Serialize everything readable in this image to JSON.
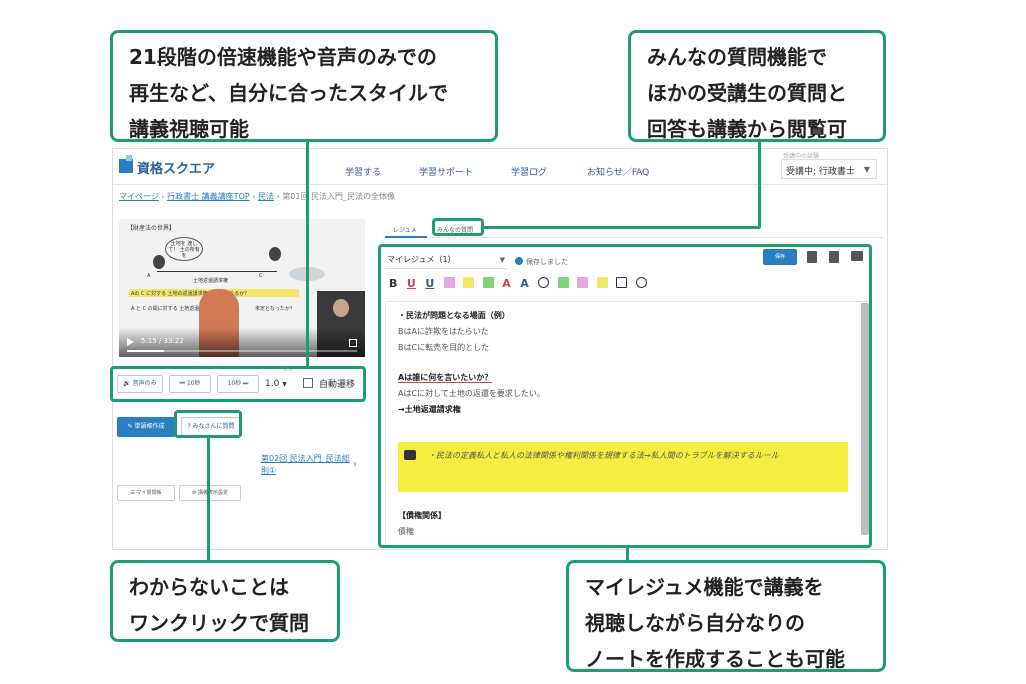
{
  "callouts": {
    "speed": [
      "21段階の倍速機能や音声のみでの",
      "再生など、自分に合ったスタイルで",
      "講義視聴可能"
    ],
    "questions": [
      "みんなの質問機能で",
      "ほかの受講生の質問と",
      "回答も講義から閲覧可"
    ],
    "oneclick": [
      "わからないことは",
      "ワンクリックで質問"
    ],
    "resume": [
      "マイレジュメ機能で講義を",
      "視聴しながら自分なりの",
      "ノートを作成することも可能"
    ]
  },
  "app": {
    "logo": "資格スクエア",
    "nav": [
      "学習する",
      "学習サポート",
      "学習ログ",
      "お知らせ／FAQ"
    ],
    "exam_label": "受講中の試験",
    "exam_value": "受講中: 行政書士",
    "breadcrumb": [
      "マイページ",
      "行政書士 講義講座TOP",
      "民法",
      "第01回 民法入門_民法の全体像"
    ]
  },
  "video": {
    "slide_title": "【財産法の世界】",
    "bubble": "土地を 渡して！ 土の所有を",
    "labels": [
      "A",
      "C",
      "土地返還請求権",
      "Aの C に対する 土地の返還請求権が 認められるか？",
      "A と C の間に対する 土地返還を 争う権利が",
      "未定となったか？"
    ],
    "time": "5:15 / 33:22",
    "progress": 0.16
  },
  "controls": {
    "speed_label": "速度",
    "audio_only": "🔊 音声のみ",
    "back10": "⏮ 10秒",
    "forward10": "10秒 ⏭",
    "speed_value": "1.0",
    "auto_transition": "自動遷移"
  },
  "actions": {
    "create_note": "✎ 単語帳作成",
    "ask_question": "? みなさんに質問",
    "next_lecture": "第02回 民法入門_民法総則①",
    "my_questions": "☰ マイ質問帳",
    "display_settings": "⚙ 講義表示設定"
  },
  "resume": {
    "tabs": [
      "レジュメ",
      "みんなの質問"
    ],
    "title": "マイレジュメ（1）",
    "saved": "保存しました",
    "save_btn": "保存",
    "format_buttons": [
      "B",
      "U",
      "U"
    ],
    "format_buttons2": [
      "A",
      "A"
    ],
    "lines": {
      "l1": "・民法が問題となる場面（例）",
      "l2": "BはAに詐欺をはたらいた",
      "l3": "BはCに転売を目的とした",
      "l4": "Aは誰に何を言いたいか？",
      "l5": "AはCに対して土地の返還を要求したい。",
      "l6": "→土地返還請求権",
      "sticky": "・民法の定義私人と私人の法律関係や権利関係を規律する法→私人間のトラブルを解決するルール",
      "l7": "【債権関係】",
      "l8": "債権"
    }
  }
}
